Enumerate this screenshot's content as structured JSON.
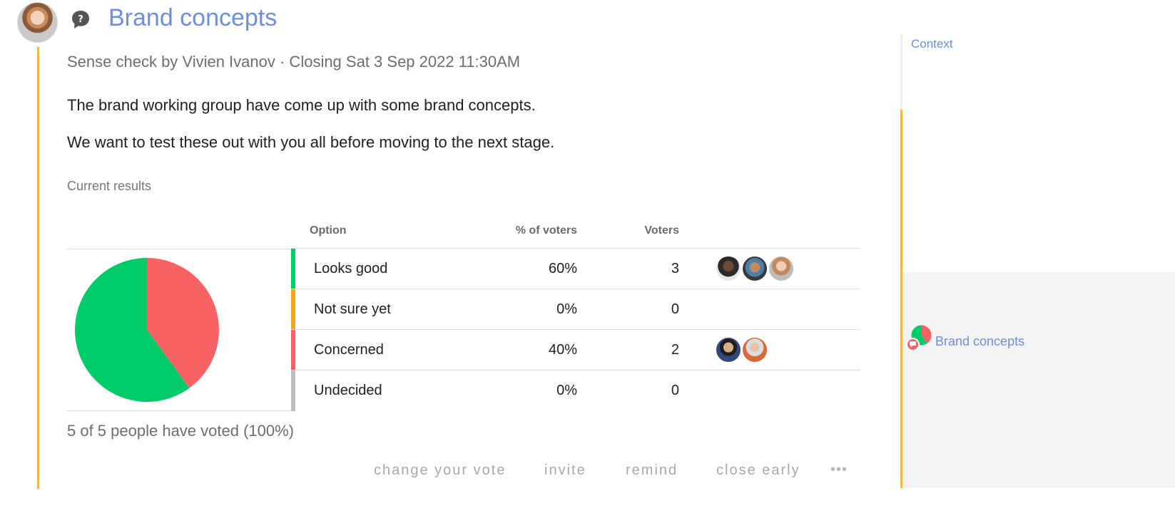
{
  "header": {
    "title": "Brand concepts",
    "avatar": "author-avatar",
    "poll_icon": "help-bubble-icon"
  },
  "poll": {
    "meta": "Sense check by Vivien Ivanov · Closing Sat 3 Sep 2022 11:30AM",
    "description": [
      "The brand working group have come up with some brand concepts.",
      "We want to test these out with you all before moving to the next stage."
    ],
    "results_label": "Current results",
    "voted_summary": "5 of 5 people have voted (100%)"
  },
  "table": {
    "headers": {
      "option": "Option",
      "percent": "% of voters",
      "voters": "Voters"
    },
    "rows": [
      {
        "option": "Looks good",
        "percent": "60%",
        "voters": "3",
        "color": "#00cc6a",
        "avatars": 3
      },
      {
        "option": "Not sure yet",
        "percent": "0%",
        "voters": "0",
        "color": "#f6a623",
        "avatars": 0
      },
      {
        "option": "Concerned",
        "percent": "40%",
        "voters": "2",
        "color": "#f76364",
        "avatars": 2
      },
      {
        "option": "Undecided",
        "percent": "0%",
        "voters": "0",
        "color": "#bdbdbd",
        "avatars": 0
      }
    ]
  },
  "chart_data": {
    "type": "pie",
    "categories": [
      "Looks good",
      "Not sure yet",
      "Concerned",
      "Undecided"
    ],
    "values": [
      60,
      0,
      40,
      0
    ],
    "colors": [
      "#00cc6a",
      "#f6a623",
      "#f76364",
      "#bdbdbd"
    ]
  },
  "actions": {
    "change_vote": "change your vote",
    "invite": "invite",
    "remind": "remind",
    "close_early": "close early",
    "more": "•••"
  },
  "context_panel": {
    "title": "Context",
    "item": "Brand concepts"
  },
  "colors": {
    "accent": "#6c8fe0",
    "thread": "#f6b73c"
  }
}
